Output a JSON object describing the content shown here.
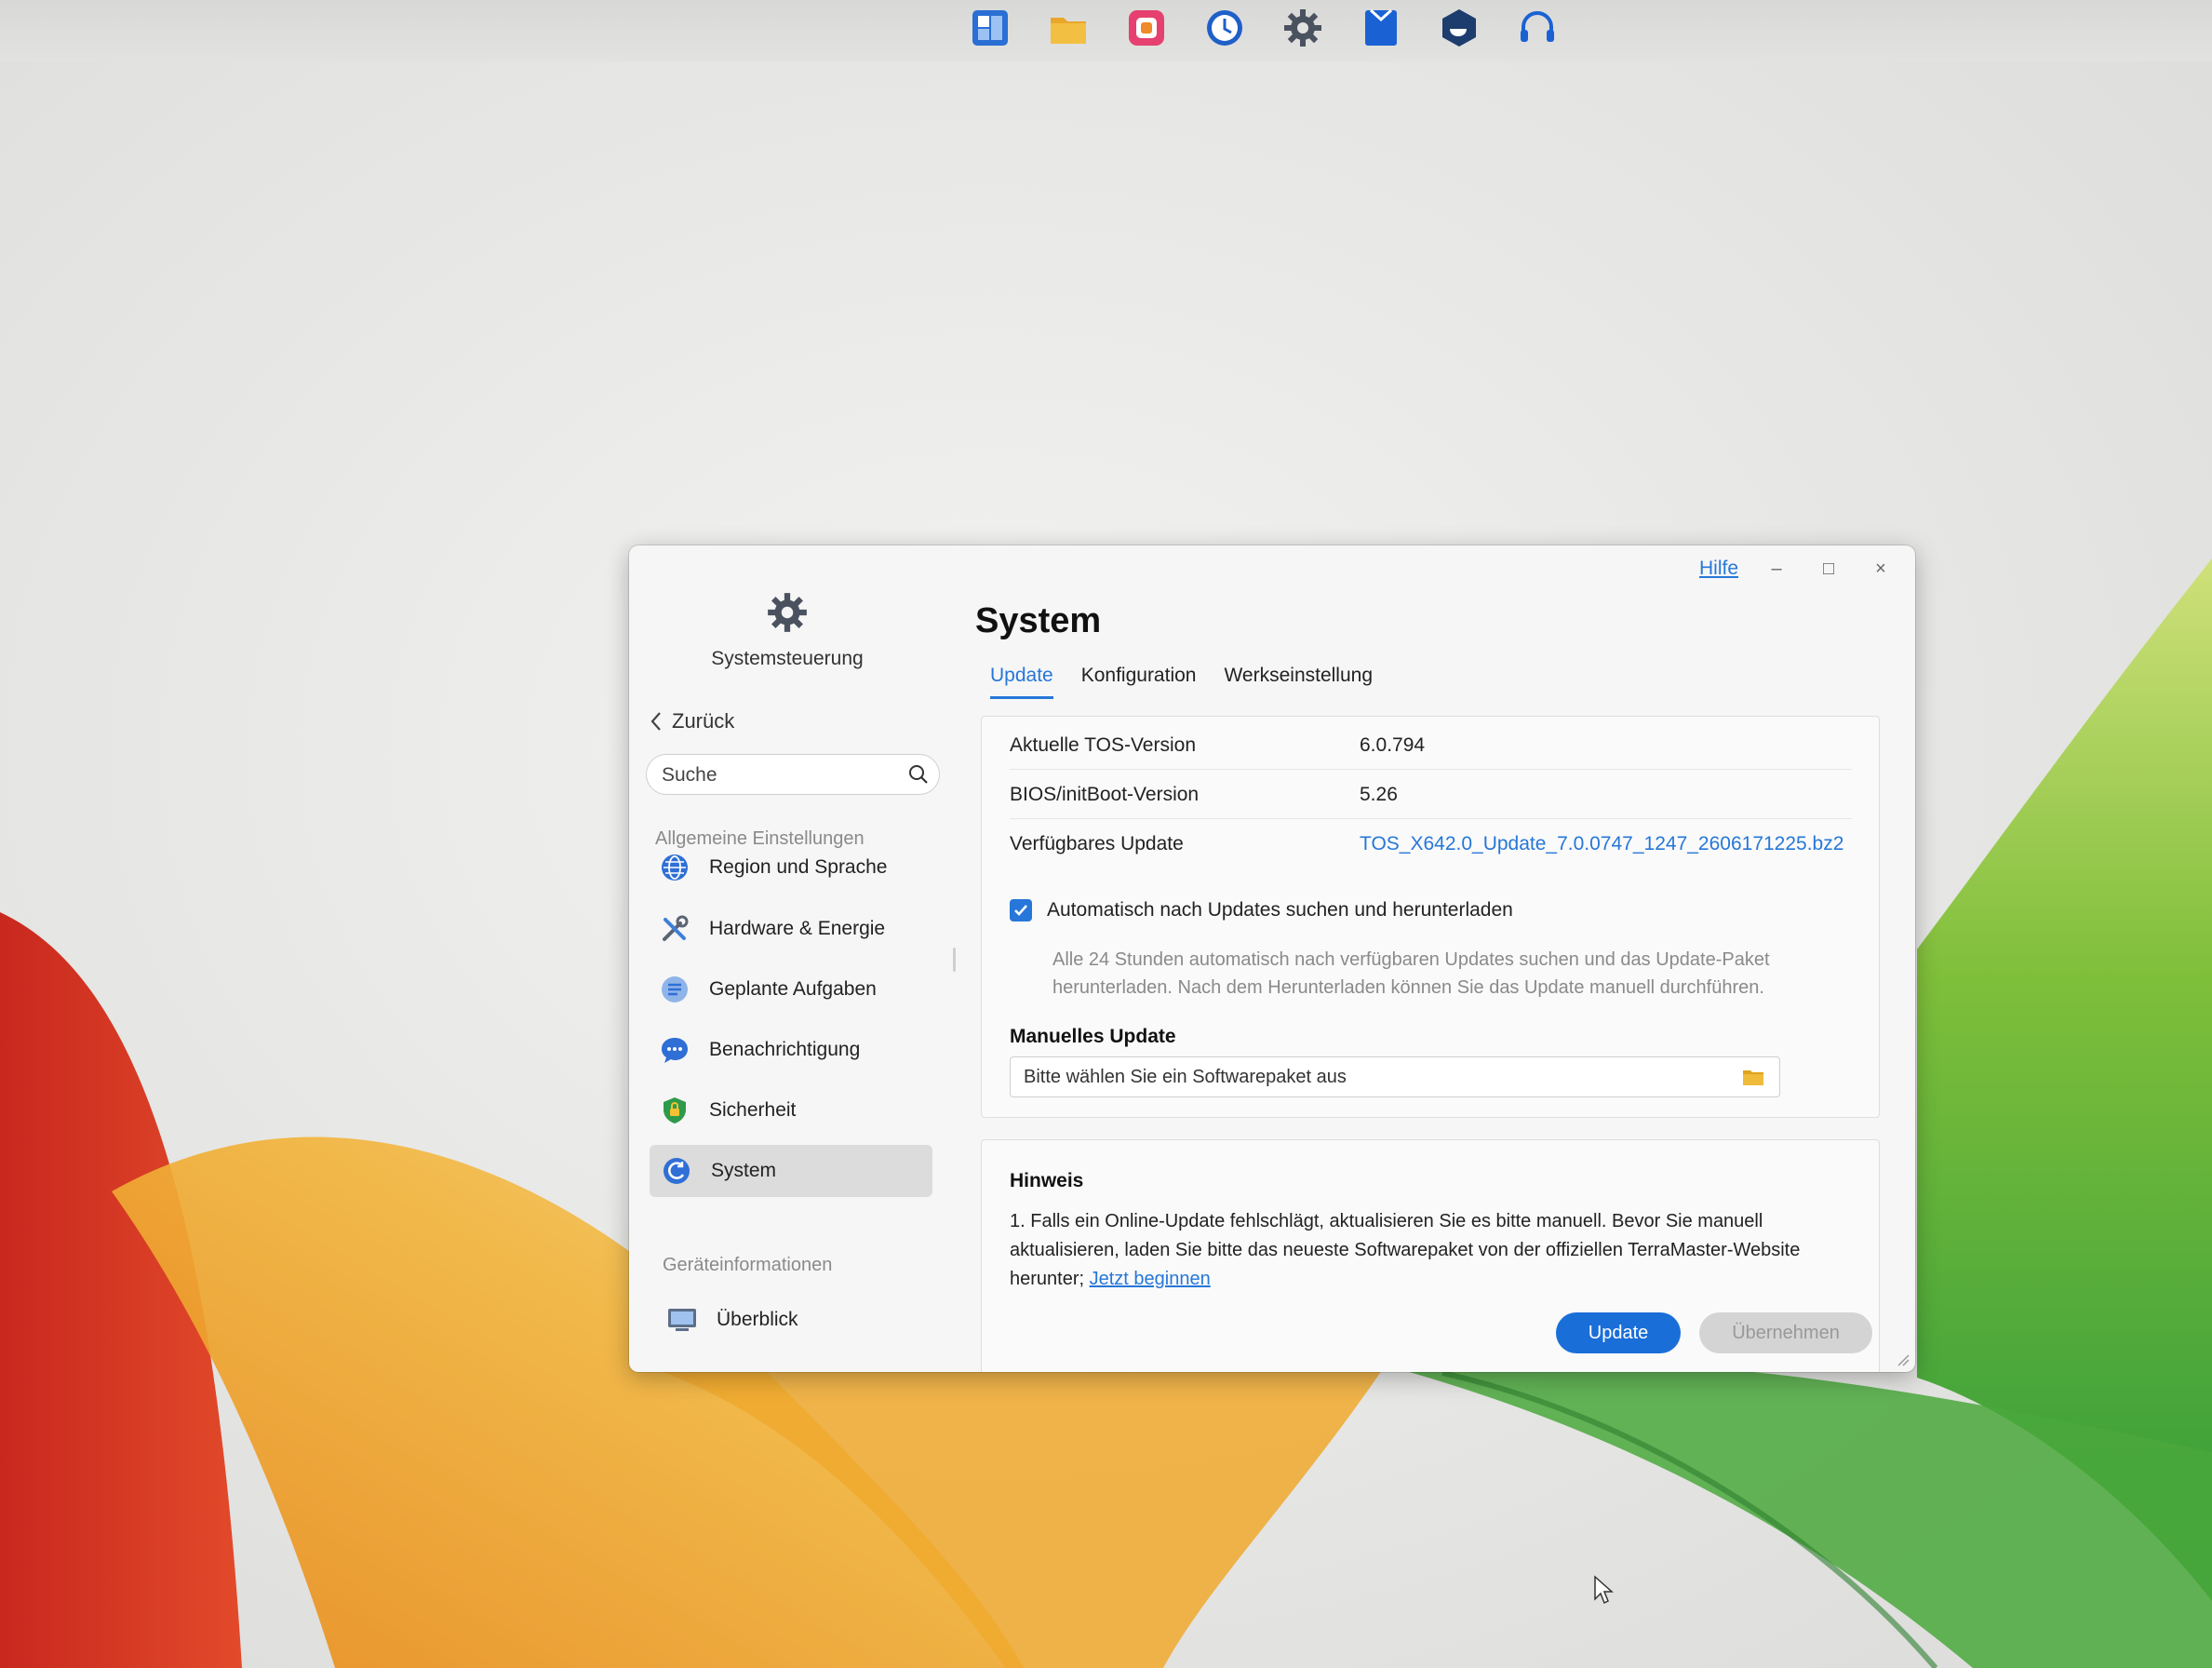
{
  "dock": {
    "icons": [
      "file-manager-icon",
      "folder-icon",
      "app-center-icon",
      "backup-clock-icon",
      "settings-gear-icon",
      "storage-icon",
      "docker-icon",
      "support-headset-icon"
    ]
  },
  "window": {
    "help": "Hilfe",
    "minimize": "–",
    "maximize": "□",
    "close": "×"
  },
  "sidebar": {
    "app_name": "Systemsteuerung",
    "back": "Zurück",
    "search_placeholder": "Suche",
    "group_general": "Allgemeine Einstellungen",
    "items": [
      {
        "label": "Region und Sprache",
        "icon": "globe-icon"
      },
      {
        "label": "Hardware & Energie",
        "icon": "tools-icon"
      },
      {
        "label": "Geplante Aufgaben",
        "icon": "tasks-icon"
      },
      {
        "label": "Benachrichtigung",
        "icon": "chat-icon"
      },
      {
        "label": "Sicherheit",
        "icon": "shield-icon"
      },
      {
        "label": "System",
        "icon": "system-icon"
      }
    ],
    "group_device": "Geräteinformationen",
    "device_items": [
      {
        "label": "Überblick",
        "icon": "monitor-icon"
      }
    ]
  },
  "main": {
    "title": "System",
    "tabs": [
      "Update",
      "Konfiguration",
      "Werkseinstellung"
    ],
    "info": [
      {
        "label": "Aktuelle TOS-Version",
        "value": "6.0.794"
      },
      {
        "label": "BIOS/initBoot-Version",
        "value": "5.26"
      },
      {
        "label": "Verfügbares Update",
        "value": "TOS_X642.0_Update_7.0.0747_1247_2606171225.bz2"
      }
    ],
    "auto_update_label": "Automatisch nach Updates suchen und herunterladen",
    "auto_update_desc": "Alle 24 Stunden automatisch nach verfügbaren Updates suchen und das Update-Paket herunterladen. Nach dem Herunterladen können Sie das Update manuell durchführen.",
    "manual_title": "Manuelles Update",
    "manual_placeholder": "Bitte wählen Sie ein Softwarepaket aus",
    "hint_title": "Hinweis",
    "hint_text": "1. Falls ein Online-Update fehlschlägt, aktualisieren Sie es bitte manuell. Bevor Sie manuell aktualisieren, laden Sie bitte das neueste Softwarepaket von der offiziellen TerraMaster-Website herunter;",
    "hint_link": "Jetzt beginnen",
    "btn_update": "Update",
    "btn_apply": "Übernehmen"
  },
  "colors": {
    "accent": "#2677d9",
    "primary_button": "#1a6ed8"
  }
}
